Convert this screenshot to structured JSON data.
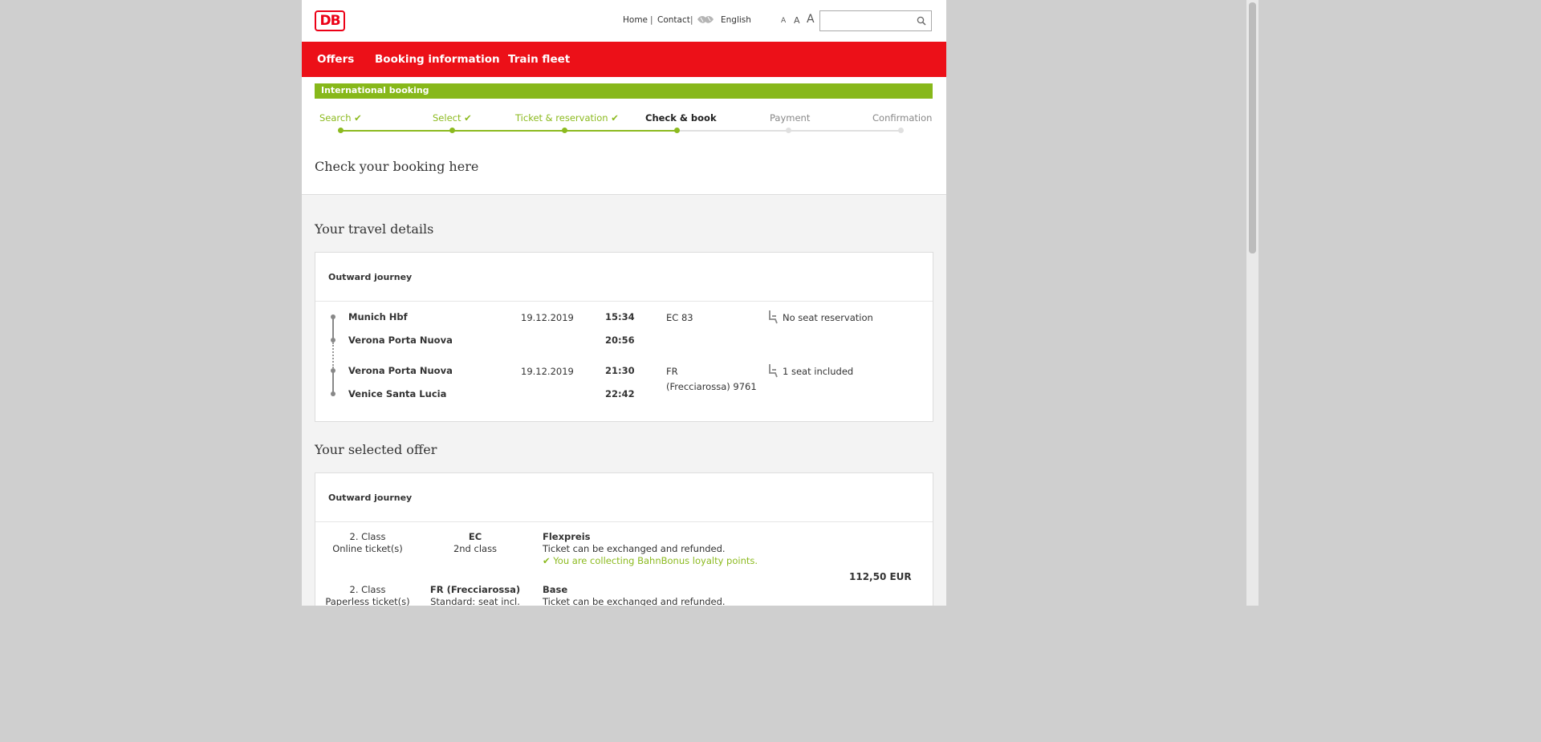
{
  "header": {
    "logo_text": "DB",
    "links": {
      "home": "Home",
      "sep1": "|",
      "contact": "Contact",
      "sep2": "|",
      "language": "English"
    },
    "font_sizes": [
      "A",
      "A",
      "A"
    ],
    "search": {
      "placeholder": ""
    }
  },
  "nav": {
    "items": [
      "Offers",
      "Booking information",
      "Train fleet"
    ]
  },
  "booking_bar": {
    "title": "International booking"
  },
  "steps": [
    {
      "label": "Search",
      "state": "done"
    },
    {
      "label": "Select",
      "state": "done"
    },
    {
      "label": "Ticket & reservation",
      "state": "done"
    },
    {
      "label": "Check & book",
      "state": "active"
    },
    {
      "label": "Payment",
      "state": "todo"
    },
    {
      "label": "Confirmation",
      "state": "todo"
    }
  ],
  "page_title": "Check your booking here",
  "travel_details": {
    "heading": "Your travel details",
    "card_title": "Outward journey",
    "legs": [
      {
        "from": "Munich Hbf",
        "to": "Verona Porta Nuova",
        "date": "19.12.2019",
        "dep": "15:34",
        "arr": "20:56",
        "train": "EC 83",
        "train2": "",
        "seat": "No seat reservation"
      },
      {
        "from": "Verona Porta Nuova",
        "to": "Venice Santa Lucia",
        "date": "19.12.2019",
        "dep": "21:30",
        "arr": "22:42",
        "train": "FR",
        "train2": "(Frecciarossa) 9761",
        "seat": "1 seat included"
      }
    ]
  },
  "selected_offer": {
    "heading": "Your selected offer",
    "card_title": "Outward journey",
    "rows": [
      {
        "class": "2. Class",
        "ticket": "Online ticket(s)",
        "train": "EC",
        "train_class": "2nd class",
        "fare": "Flexpreis",
        "fare_desc": "Ticket can be exchanged and refunded.",
        "bonus": "You are collecting BahnBonus loyalty points."
      },
      {
        "class": "2. Class",
        "ticket": "Paperless ticket(s)",
        "train": "FR (Frecciarossa)",
        "train_class": "Standard: seat incl.",
        "fare": "Base",
        "fare_desc": "Ticket can be exchanged and refunded."
      }
    ],
    "price": "112,50 EUR"
  },
  "colors": {
    "db_red": "#ec1018",
    "green": "#87b81a",
    "page_bg": "#f3f3f3"
  }
}
